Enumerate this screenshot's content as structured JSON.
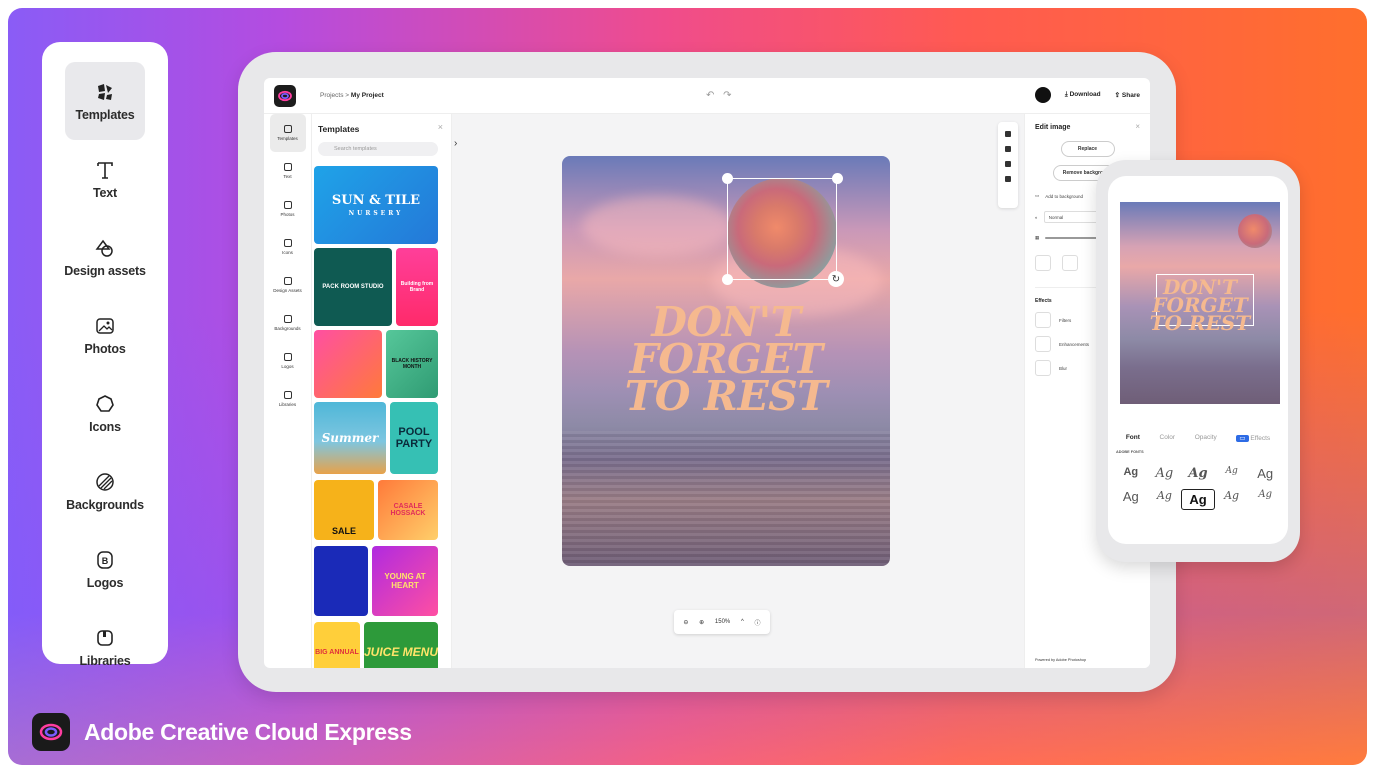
{
  "sidebar": {
    "items": [
      {
        "label": "Templates",
        "icon": "templates-icon",
        "active": true
      },
      {
        "label": "Text",
        "icon": "text-icon",
        "active": false
      },
      {
        "label": "Design assets",
        "icon": "design-assets-icon",
        "active": false
      },
      {
        "label": "Photos",
        "icon": "photos-icon",
        "active": false
      },
      {
        "label": "Icons",
        "icon": "icons-icon",
        "active": false
      },
      {
        "label": "Backgrounds",
        "icon": "backgrounds-icon",
        "active": false
      },
      {
        "label": "Logos",
        "icon": "logos-icon",
        "active": false
      },
      {
        "label": "Libraries",
        "icon": "libraries-icon",
        "active": false
      }
    ]
  },
  "brand": {
    "name": "Adobe Creative Cloud Express"
  },
  "app": {
    "breadcrumb_parent": "Projects",
    "breadcrumb_sep": ">",
    "breadcrumb_current": "My Project",
    "download_label": "Download",
    "share_label": "Share",
    "undo_redo": "↶ ↷"
  },
  "rail": {
    "items": [
      "Templates",
      "Text",
      "Photos",
      "Icons",
      "Design Assets",
      "Backgrounds",
      "Logos",
      "Libraries"
    ]
  },
  "templates_panel": {
    "title": "Templates",
    "close": "×",
    "search_placeholder": "Search templates",
    "cards": [
      {
        "title": "SUN & TILE",
        "sub": "NURSERY"
      },
      {
        "title": "PACK ROOM STUDIO",
        "sub": ""
      },
      {
        "title": "Building from Brand",
        "sub": ""
      },
      {
        "title": "",
        "sub": ""
      },
      {
        "title": "BLACK HISTORY MONTH",
        "sub": ""
      },
      {
        "title": "Summer",
        "sub": ""
      },
      {
        "title": "POOL PARTY",
        "sub": ""
      },
      {
        "title": "SALE",
        "sub": ""
      },
      {
        "title": "CASALE HOSSACK",
        "sub": ""
      },
      {
        "title": "",
        "sub": ""
      },
      {
        "title": "YOUNG AT HEART",
        "sub": ""
      },
      {
        "title": "BIG ANNUAL",
        "sub": ""
      },
      {
        "title": "JUICE MENU",
        "sub": ""
      }
    ]
  },
  "canvas": {
    "headline_lines": [
      "DON'T",
      "FORGET",
      "TO REST"
    ],
    "zoom": "150%"
  },
  "edit_panel": {
    "title": "Edit image",
    "close": "×",
    "replace_label": "Replace",
    "remove_bg_label": "Remove background",
    "add_to_bg_label": "Add to background",
    "blend_mode": "Normal",
    "effects_title": "Effects",
    "effects": [
      "Filters",
      "Enhancements",
      "Blur"
    ],
    "powered_by": "Powered by Adobe Photoshop"
  },
  "phone": {
    "headline_lines": [
      "DON'T",
      "FORGET",
      "TO REST"
    ],
    "tabs": [
      "Font",
      "Color",
      "Opacity",
      "Effects"
    ],
    "fonts_label": "ADOBE FONTS",
    "font_sample": "Ag"
  },
  "colors": {
    "gradient_left": "#8a5cf6",
    "gradient_mid": "#ef4c8d",
    "gradient_right": "#ff6f2c",
    "headline": "#f5b98f",
    "accent_blue": "#2d6be5"
  }
}
